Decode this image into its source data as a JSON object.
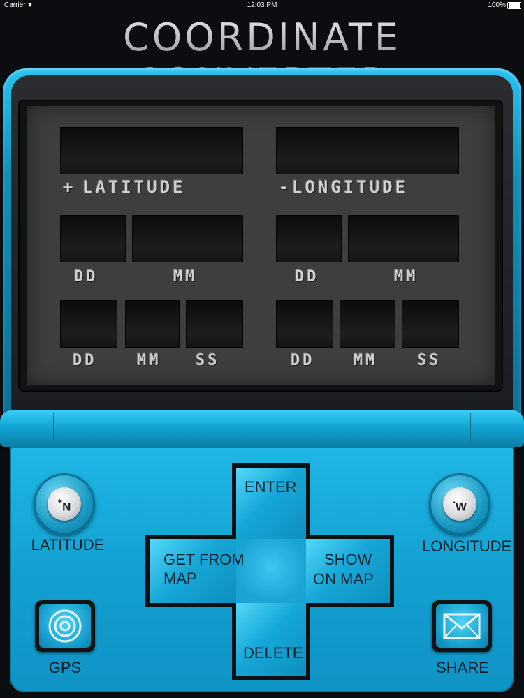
{
  "status_bar": {
    "carrier": "Carrier",
    "time": "12:03 PM",
    "battery": "100%"
  },
  "app": {
    "title": "COORDINATE CONVERTER"
  },
  "screen": {
    "latitude": {
      "sign": "+",
      "label": "LATITUDE",
      "dm_labels": [
        "DD",
        "MM"
      ],
      "dms_labels": [
        "DD",
        "MM",
        "SS"
      ]
    },
    "longitude": {
      "sign": "-",
      "label": "LONGITUDE",
      "dm_labels": [
        "DD",
        "MM"
      ],
      "dms_labels": [
        "DD",
        "MM",
        "SS"
      ]
    }
  },
  "controls": {
    "latitude_button": {
      "cap": "N",
      "sign": "+",
      "caption": "LATITUDE"
    },
    "longitude_button": {
      "cap": "W",
      "sign": "-",
      "caption": "LONGITUDE"
    },
    "gps_button": {
      "caption": "GPS",
      "icon": "target-rings-icon"
    },
    "share_button": {
      "caption": "SHARE",
      "icon": "envelope-icon"
    },
    "dpad": {
      "up": "ENTER",
      "down": "DELETE",
      "left_line1": "GET FROM",
      "left_line2": "MAP",
      "right_line1": "SHOW",
      "right_line2": "ON MAP"
    }
  },
  "colors": {
    "shell_cyan": "#13a1d2",
    "screen_gray": "#3d3e40",
    "display_field": "#141415"
  }
}
